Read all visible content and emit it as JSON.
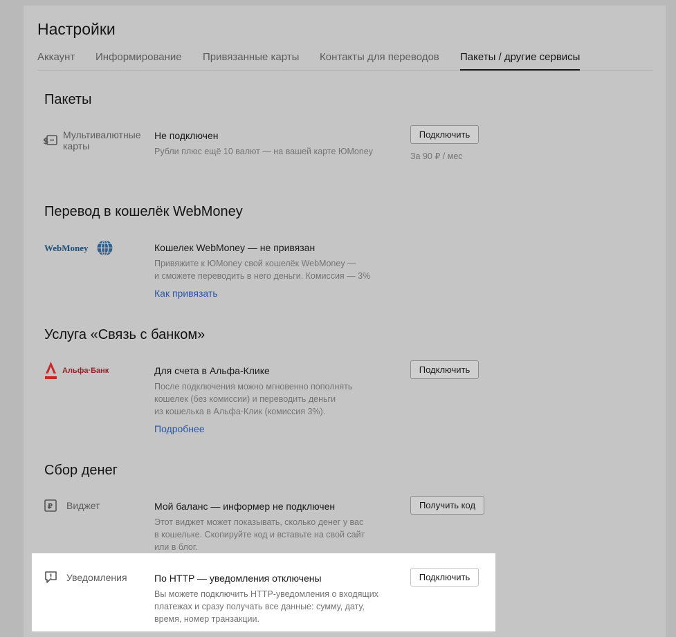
{
  "page": {
    "title": "Настройки"
  },
  "tabs": [
    {
      "label": "Аккаунт"
    },
    {
      "label": "Информирование"
    },
    {
      "label": "Привязанные карты"
    },
    {
      "label": "Контакты для переводов"
    },
    {
      "label": "Пакеты / другие сервисы",
      "active": true
    }
  ],
  "packages": {
    "title": "Пакеты",
    "label_line1": "Мультивалютные",
    "label_line2": "карты",
    "status": "Не подключен",
    "description": "Рубли плюс ещё 10 валют — на вашей карте ЮMoney",
    "button": "Подключить",
    "price": "За 90 ₽ / мес",
    "icon": "multicurrency-card-icon"
  },
  "webmoney": {
    "title": "Перевод в кошелёк WebMoney",
    "logo_text": "WebMoney",
    "status": "Кошелек WebMoney — не привязан",
    "desc_line1": "Привяжите к ЮMoney свой кошелёк WebMoney —",
    "desc_line2": "и сможете переводить в него деньги. Комиссия — 3%",
    "link": "Как привязать"
  },
  "bank": {
    "title": "Услуга «Связь с банком»",
    "logo_text": "Альфа·Банк",
    "status": "Для счета в Альфа-Клике",
    "desc_line1": "После подключения можно мгновенно пополнять",
    "desc_line2": "кошелек (без комиссии) и переводить деньги",
    "desc_line3": "из кошелька в Альфа-Клик (комиссия 3%).",
    "link": "Подробнее",
    "button": "Подключить"
  },
  "fundraising": {
    "title": "Сбор денег",
    "widget": {
      "label": "Виджет",
      "status": "Мой баланс — информер не подключен",
      "desc_line1": "Этот виджет может показывать, сколько денег у вас",
      "desc_line2": "в кошельке. Скопируйте код и вставьте на свой сайт",
      "desc_line3": "или в блог.",
      "button": "Получить код"
    },
    "notifications": {
      "label": "Уведомления",
      "status": "По HTTP — уведомления отключены",
      "desc_line1": "Вы можете подключить HTTP-уведомления о входящих",
      "desc_line2": "платежах и сразу получать все данные: сумму, дату,",
      "desc_line3": "время, номер транзакции.",
      "button": "Подключить"
    }
  },
  "colors": {
    "link": "#2a56a8",
    "alfa_red": "#c8282b",
    "webmoney_blue": "#1d4f79"
  }
}
